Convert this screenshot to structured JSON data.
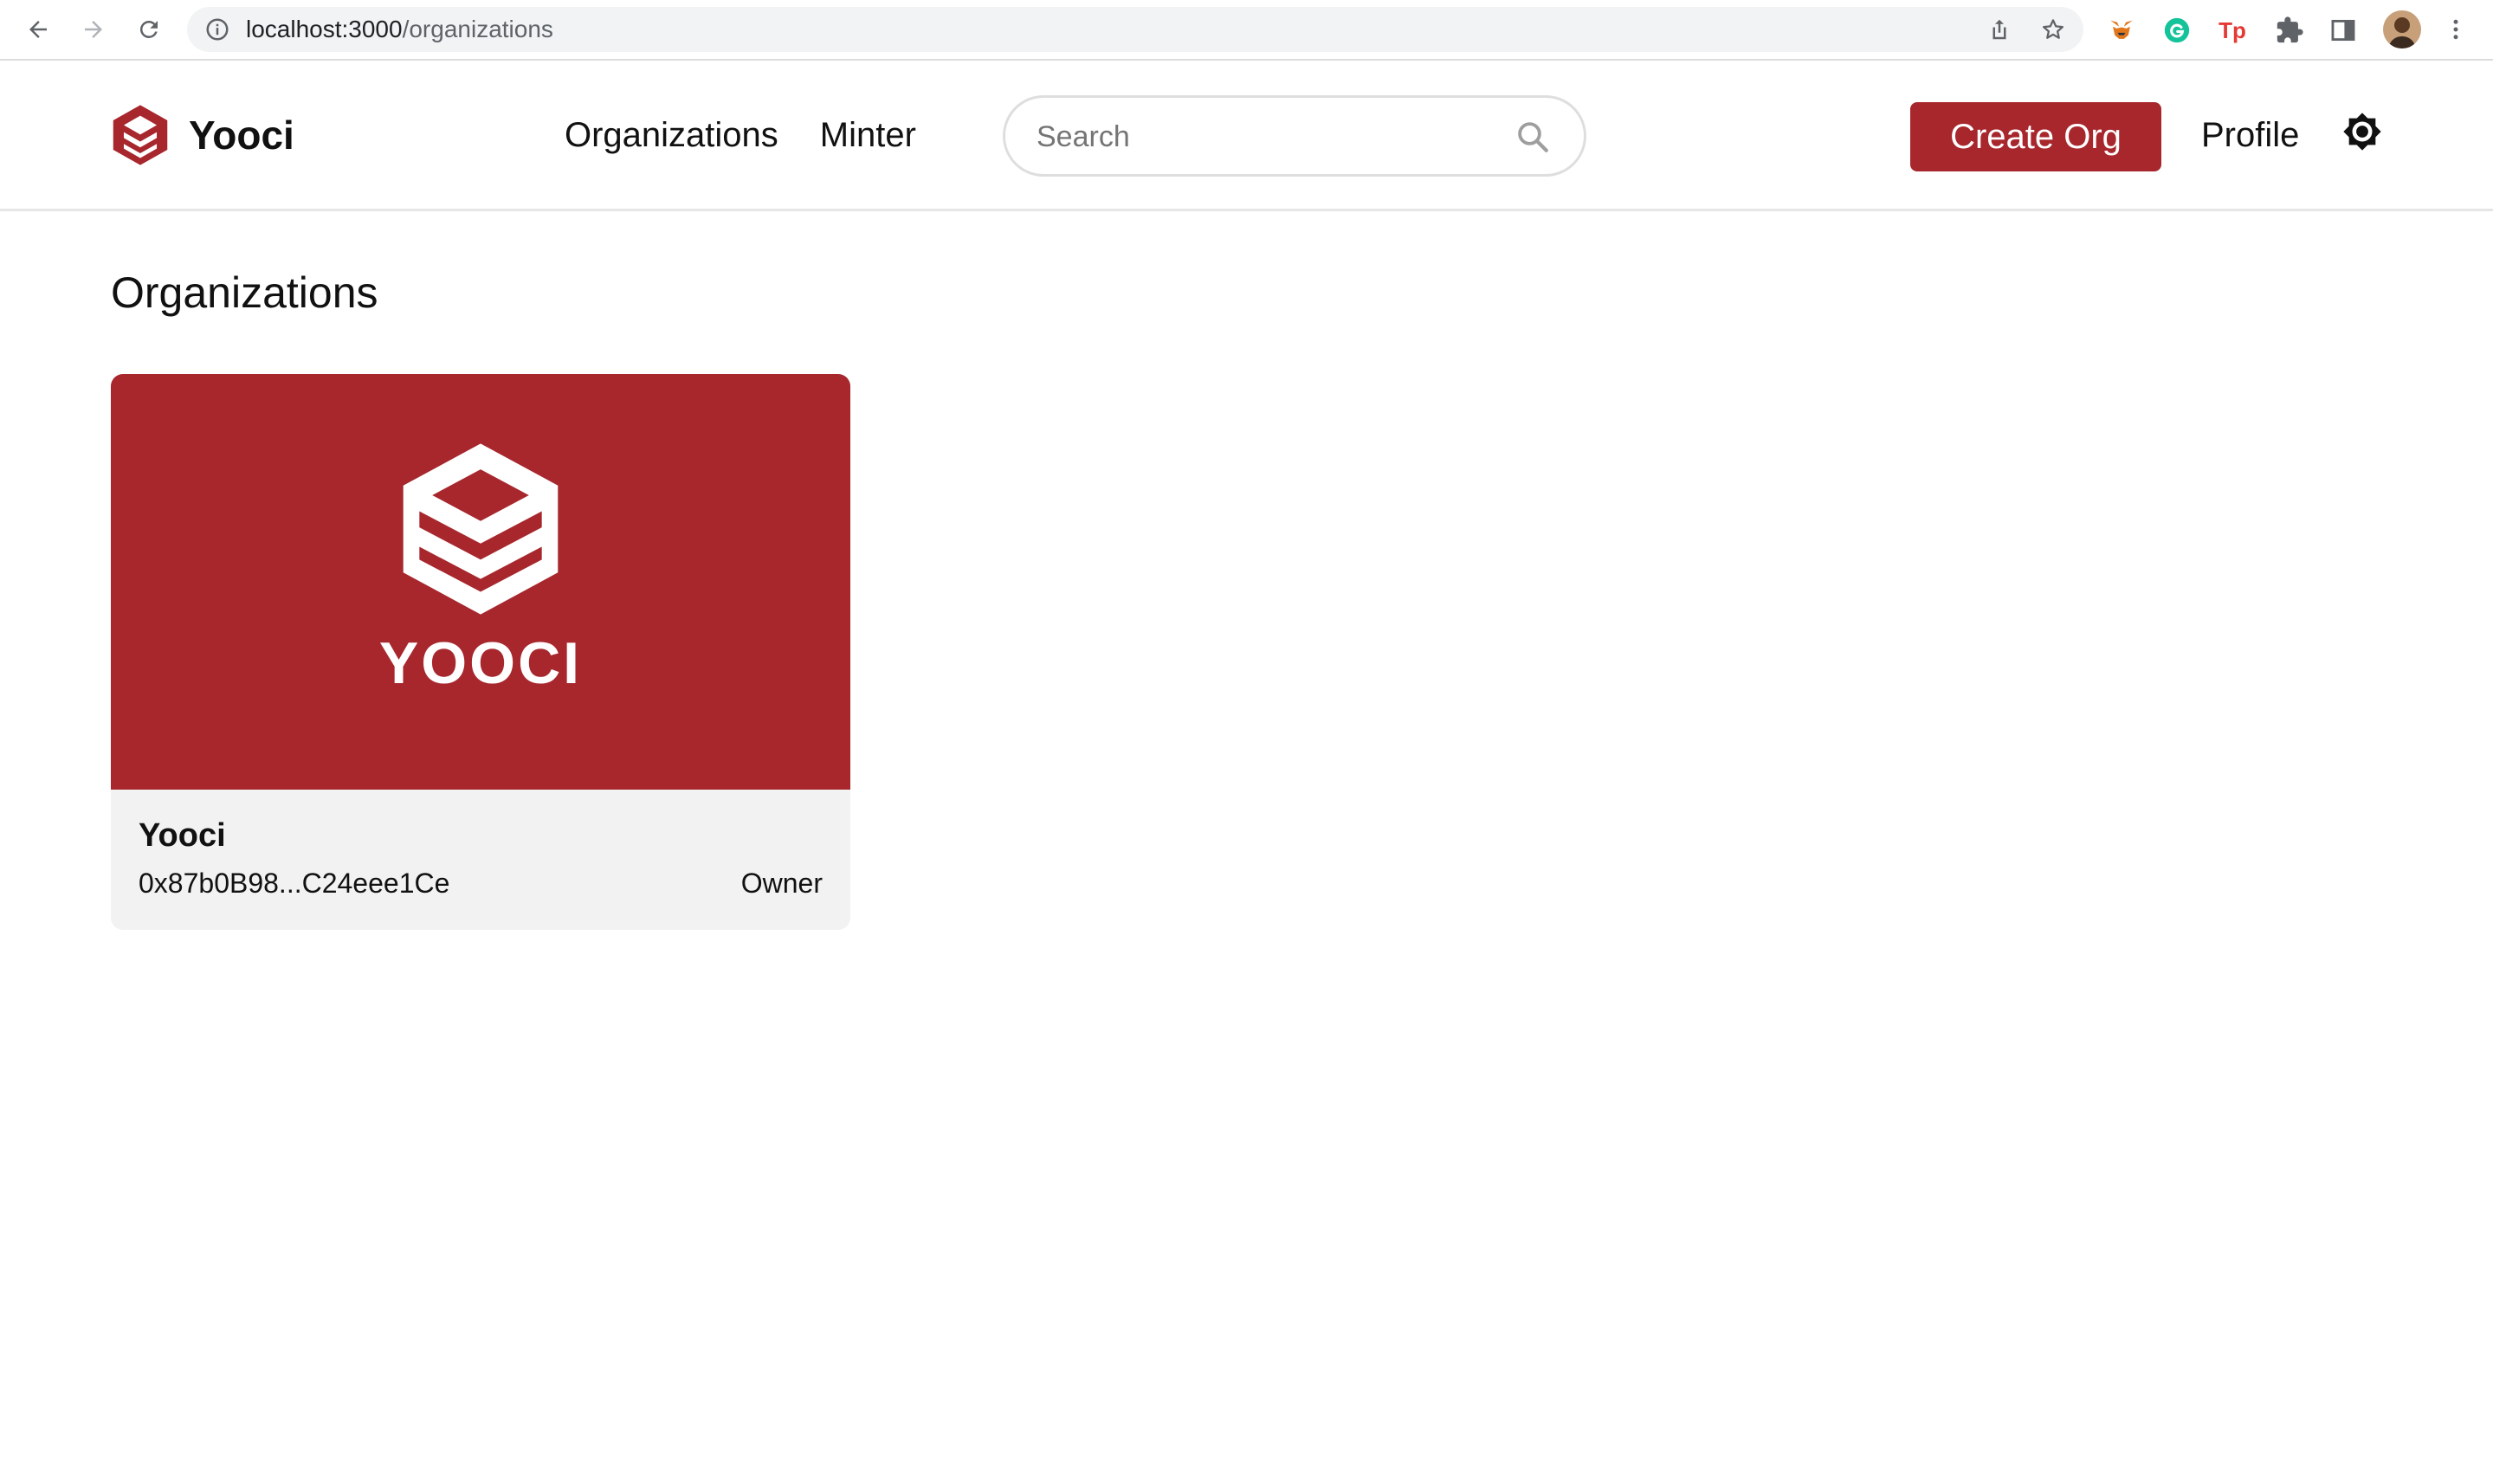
{
  "browser": {
    "url_host": "localhost:3000",
    "url_path": "/organizations",
    "extensions": [
      "metamask-fox-icon",
      "grammarly-icon",
      "tp-icon",
      "puzzle-icon",
      "side-panel-icon"
    ],
    "extension_tp_label": "Tp"
  },
  "header": {
    "brand_name": "Yooci",
    "nav": [
      {
        "label": "Organizations"
      },
      {
        "label": "Minter"
      }
    ],
    "search_placeholder": "Search",
    "create_button_label": "Create Org",
    "profile_label": "Profile"
  },
  "main": {
    "title": "Organizations",
    "cards": [
      {
        "banner_wordmark": "YOOCI",
        "name": "Yooci",
        "address": "0x87b0B98...C24eee1Ce",
        "role": "Owner"
      }
    ]
  },
  "colors": {
    "brand_red": "#a7272d",
    "card_background": "#f2f2f2"
  }
}
